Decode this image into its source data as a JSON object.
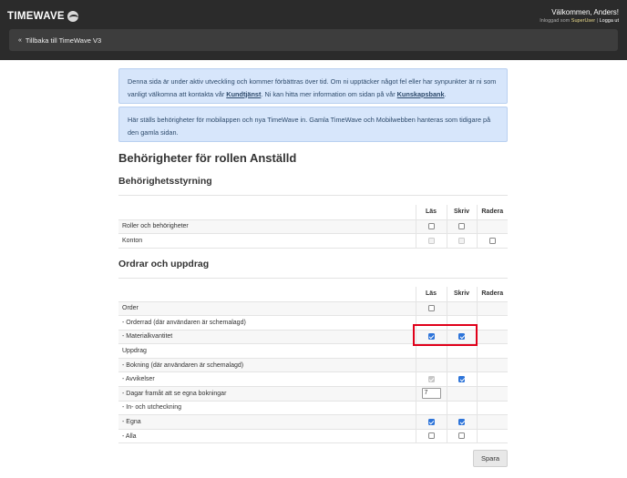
{
  "header": {
    "logo_text": "TIMEWAVE",
    "welcome": "Välkommen, Anders!",
    "logged_in_prefix": "Inloggad som",
    "logged_in_user": "SuperUser",
    "separator": "|",
    "logout_label": "Logga ut",
    "back_chevron": "«",
    "back_label": "Tillbaka till TimeWave V3"
  },
  "notices": {
    "dev_text_1": "Denna sida är under aktiv utveckling och kommer förbättras över tid. Om ni upptäcker något fel eller har synpunkter är ni som vanligt välkomna att kontakta vår ",
    "dev_link_support": "Kundtjänst",
    "dev_text_2": ". Ni kan hitta mer information om sidan på vår ",
    "dev_link_kb": "Kunskapsbank",
    "dev_text_3": ".",
    "info_text": "Här ställs behörigheter för mobilappen och nya TimeWave in. Gamla TimeWave och Mobilwebben hanteras som tidigare på den gamla sidan."
  },
  "page_title": "Behörigheter för rollen Anställd",
  "columns": {
    "read": "Läs",
    "write": "Skriv",
    "delete": "Radera"
  },
  "sections": [
    {
      "title": "Behörighetsstyrning",
      "rows": [
        {
          "label": "Roller och behörigheter",
          "read": "unchecked",
          "write": "unchecked",
          "delete": "none"
        },
        {
          "label": "Konton",
          "read": "disabled",
          "write": "disabled",
          "delete": "unchecked"
        }
      ]
    },
    {
      "title": "Ordrar och uppdrag",
      "rows": [
        {
          "label": "Order",
          "read": "unchecked",
          "write": "none",
          "delete": "none"
        },
        {
          "label": "- Orderrad (där användaren är schemalagd)",
          "read": "none",
          "write": "none",
          "delete": "none"
        },
        {
          "label": "- Materialkvantitet",
          "read": "checked",
          "write": "checked",
          "delete": "none"
        },
        {
          "label": "Uppdrag",
          "read": "none",
          "write": "none",
          "delete": "none"
        },
        {
          "label": "- Bokning (där användaren är schemalagd)",
          "read": "none",
          "write": "none",
          "delete": "none"
        },
        {
          "label": "- Avvikelser",
          "read": "checked-disabled",
          "write": "checked",
          "delete": "none"
        },
        {
          "label": "- Dagar framåt att se egna bokningar",
          "read": "input",
          "read_value": "7",
          "write": "none",
          "delete": "none"
        },
        {
          "label": "- In- och utcheckning",
          "read": "none",
          "write": "none",
          "delete": "none"
        },
        {
          "label": "- Egna",
          "read": "checked",
          "write": "checked",
          "delete": "none"
        },
        {
          "label": "- Alla",
          "read": "unchecked",
          "write": "unchecked",
          "delete": "none"
        }
      ]
    }
  ],
  "save_label": "Spara",
  "colors": {
    "topbar": "#2b2b2b",
    "alert_bg": "#d7e6fb",
    "checkbox_checked": "#2d74d9",
    "highlight": "#e0001a"
  }
}
